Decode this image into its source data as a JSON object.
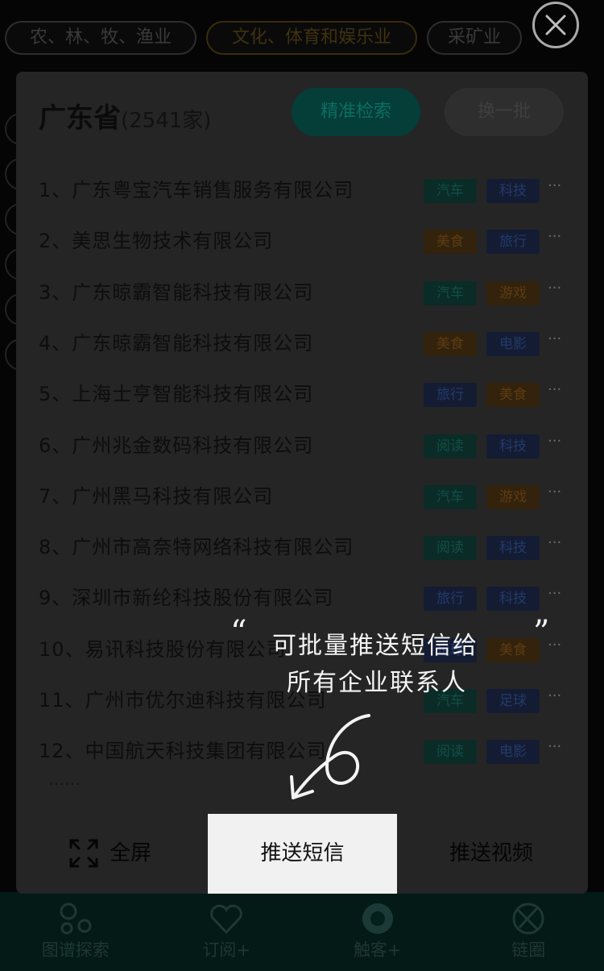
{
  "background": {
    "chips": [
      {
        "label": "农、林、牧、渔业",
        "highlight": false
      },
      {
        "label": "文化、体育和娱乐业",
        "highlight": true
      },
      {
        "label": "采矿业",
        "highlight": false
      }
    ]
  },
  "panel": {
    "province": "广东省",
    "count": "(2541家)",
    "precise_search_label": "精准检索",
    "swap_label": "换一批",
    "companies": [
      {
        "name": "1、广东粤宝汽车销售服务有限公司",
        "tags": [
          "汽车",
          "科技"
        ]
      },
      {
        "name": "2、美思生物技术有限公司",
        "tags": [
          "美食",
          "旅行"
        ]
      },
      {
        "name": "3、广东晾霸智能科技有限公司",
        "tags": [
          "汽车",
          "游戏"
        ]
      },
      {
        "name": "4、广东晾霸智能科技有限公司",
        "tags": [
          "美食",
          "电影"
        ]
      },
      {
        "name": "5、上海士亨智能科技有限公司",
        "tags": [
          "旅行",
          "美食"
        ]
      },
      {
        "name": "6、广州兆金数码科技有限公司",
        "tags": [
          "阅读",
          "科技"
        ]
      },
      {
        "name": "7、广州黑马科技有限公司",
        "tags": [
          "汽车",
          "游戏"
        ]
      },
      {
        "name": "8、广州市高奈特网络科技有限公司",
        "tags": [
          "阅读",
          "科技"
        ]
      },
      {
        "name": "9、深圳市新纶科技股份有限公司",
        "tags": [
          "旅行",
          "科技"
        ]
      },
      {
        "name": "10、易讯科技股份有限公司",
        "tags": [
          "足球",
          "美食"
        ]
      },
      {
        "name": "11、广州市优尔迪科技有限公司",
        "tags": [
          "汽车",
          "足球"
        ]
      },
      {
        "name": "12、中国航天科技集团有限公司",
        "tags": [
          "阅读",
          "电影"
        ]
      }
    ],
    "more_label": "……",
    "row_menu": "···",
    "actions": {
      "fullscreen": "全屏",
      "push_sms": "推送短信",
      "push_video": "推送视频"
    }
  },
  "tip": {
    "line1": "可批量推送短信给",
    "line2": "所有企业联系人",
    "open_quote": "“",
    "close_quote": "”"
  },
  "bottom_nav": [
    {
      "label": "图谱探索",
      "icon": "graph-icon"
    },
    {
      "label": "订阅+",
      "icon": "heart-plus-icon"
    },
    {
      "label": "触客+",
      "icon": "target-icon"
    },
    {
      "label": "链圈",
      "icon": "aperture-icon"
    }
  ],
  "tag_colors": {
    "汽车": {
      "bg": "#0b2b27",
      "fg": "#0f5047"
    },
    "科技": {
      "bg": "#141c33",
      "fg": "#233a6a"
    },
    "美食": {
      "bg": "#33220c",
      "fg": "#5d3c12"
    },
    "旅行": {
      "bg": "#141c33",
      "fg": "#233a6a"
    },
    "游戏": {
      "bg": "#33220c",
      "fg": "#5d3c12"
    },
    "电影": {
      "bg": "#141c33",
      "fg": "#233a6a"
    },
    "阅读": {
      "bg": "#0b2b27",
      "fg": "#0f5047"
    },
    "足球": {
      "bg": "#141c33",
      "fg": "#233a6a"
    }
  }
}
